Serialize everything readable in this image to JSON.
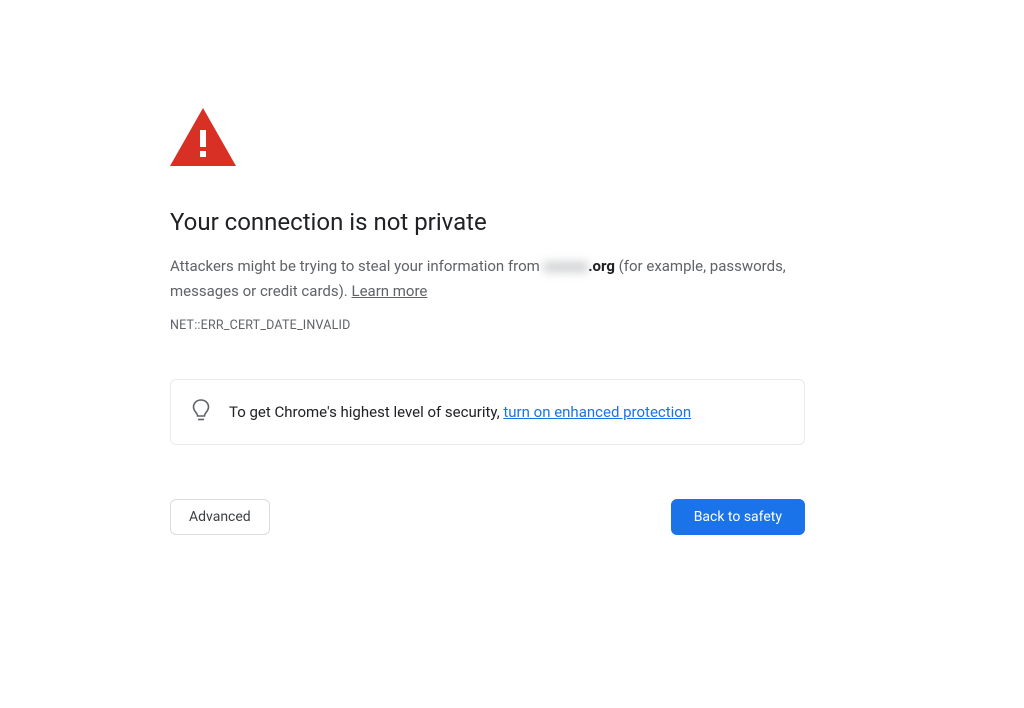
{
  "title": "Your connection is not private",
  "description": {
    "prefix": "Attackers might be trying to steal your information from ",
    "blurred_host": "xxxxxx",
    "domain_suffix": ".org",
    "suffix": " (for example, passwords, messages or credit cards). ",
    "learn_more": "Learn more"
  },
  "error_code": "NET::ERR_CERT_DATE_INVALID",
  "info": {
    "text": "To get Chrome's highest level of security, ",
    "link": "turn on enhanced protection"
  },
  "buttons": {
    "advanced": "Advanced",
    "back": "Back to safety"
  },
  "colors": {
    "danger": "#d93025",
    "primary": "#1a73e8"
  }
}
